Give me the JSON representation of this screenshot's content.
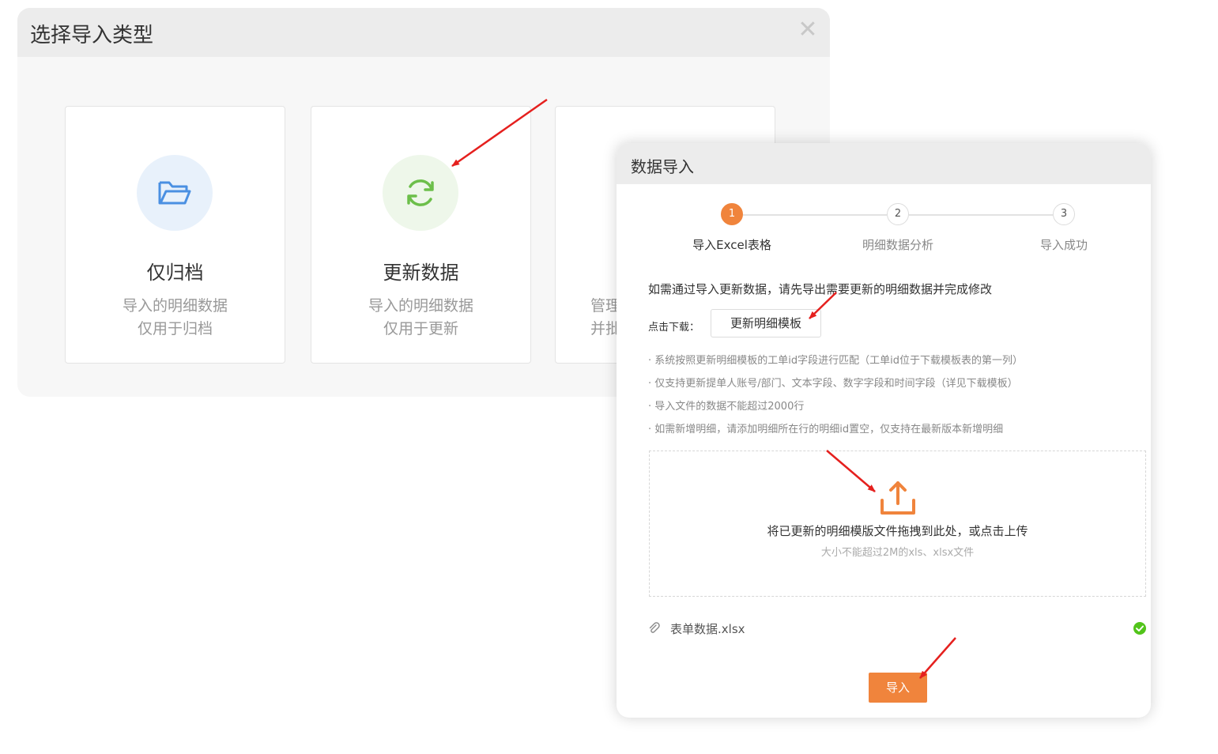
{
  "select_dialog": {
    "title": "选择导入类型",
    "close_glyph": "✕",
    "cards": [
      {
        "title": "仅归档",
        "desc1": "导入的明细数据",
        "desc2": "仅用于归档",
        "icon": "folder-open-icon",
        "icon_bg": "#e8f1fb",
        "icon_color": "#4a90e2"
      },
      {
        "title": "更新数据",
        "desc1": "导入的明细数据",
        "desc2": "仅用于更新",
        "icon": "refresh-icon",
        "icon_bg": "#eef7ea",
        "icon_color": "#6cbf4a"
      },
      {
        "title": "",
        "desc1": "管理",
        "desc2": "并批",
        "icon": ""
      }
    ]
  },
  "import_dialog": {
    "title": "数据导入",
    "steps": [
      {
        "num": "1",
        "label": "导入Excel表格",
        "state": "active"
      },
      {
        "num": "2",
        "label": "明细数据分析",
        "state": "todo"
      },
      {
        "num": "3",
        "label": "导入成功",
        "state": "todo"
      }
    ],
    "intro": "如需通过导入更新数据，请先导出需要更新的明细数据并完成修改",
    "download_label": "点击下载：",
    "download_button": "更新明细模板",
    "notes": [
      "· 系统按照更新明细模板的工单id字段进行匹配（工单id位于下载模板表的第一列）",
      "· 仅支持更新提单人账号/部门、文本字段、数字字段和时间字段（详见下载模板）",
      "· 导入文件的数据不能超过2000行",
      "· 如需新增明细，请添加明细所在行的明细id置空，仅支持在最新版本新增明细"
    ],
    "dropzone_main": "将已更新的明细模版文件拖拽到此处，或点击上传",
    "dropzone_sub": "大小不能超过2M的xls、xlsx文件",
    "file_name": "表单数据.xlsx",
    "import_button": "导入",
    "accent_color": "#f0843c"
  }
}
